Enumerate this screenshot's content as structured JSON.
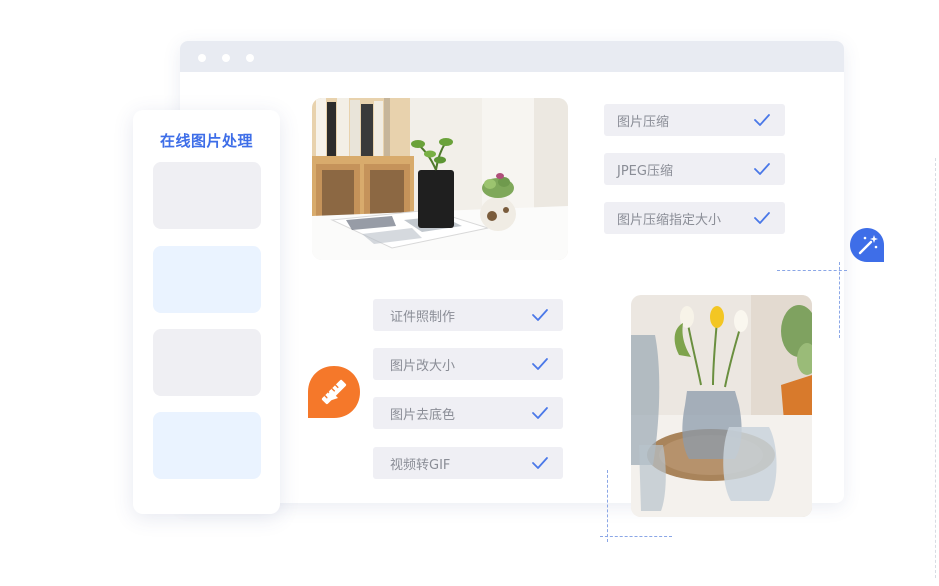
{
  "sidebar": {
    "title": "在线图片处理"
  },
  "features_top": [
    {
      "label": "图片压缩"
    },
    {
      "label": "JPEG压缩"
    },
    {
      "label": "图片压缩指定大小"
    }
  ],
  "features_bottom": [
    {
      "label": "证件照制作"
    },
    {
      "label": "图片改大小"
    },
    {
      "label": "图片去底色"
    },
    {
      "label": "视频转GIF"
    }
  ],
  "icons": {
    "check": "checkmark-icon",
    "tools_badge": "ruler-pencil-icon",
    "magic_badge": "magic-wand-icon"
  },
  "colors": {
    "accent_blue": "#3e6ee8",
    "badge_orange": "#f5782a",
    "check_blue": "#4a78e8",
    "pill_bg": "#efeff4"
  }
}
